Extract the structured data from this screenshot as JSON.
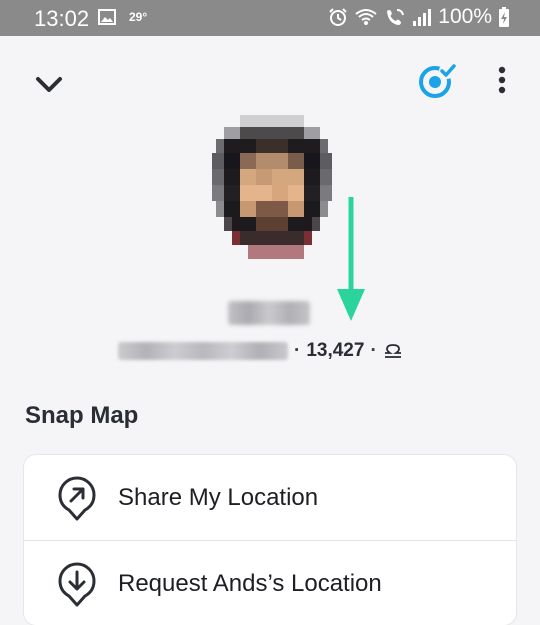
{
  "status_bar": {
    "time": "13:02",
    "temperature": "29°",
    "battery": "100%",
    "icons": [
      "gallery-icon",
      "alarm-icon",
      "wifi-icon",
      "wifi-calling-icon",
      "signal-icon",
      "battery-charging-icon"
    ]
  },
  "header": {
    "collapse_icon": "chevron-down-icon",
    "story_icon": "story-check-icon",
    "more_icon": "more-vertical-icon"
  },
  "profile": {
    "score": "13,427",
    "separator": "·",
    "zodiac_icon": "libra-icon"
  },
  "snap_map": {
    "title": "Snap Map",
    "items": [
      {
        "label": "Share My Location",
        "icon": "share-location-icon"
      },
      {
        "label": "Request Ands’s Location",
        "icon": "request-location-icon"
      }
    ]
  },
  "colors": {
    "accent_blue": "#1aa3e8",
    "annotation_green": "#2bd49b",
    "status_bar_bg": "#8a8a8a",
    "page_bg": "#f5f5f7"
  }
}
